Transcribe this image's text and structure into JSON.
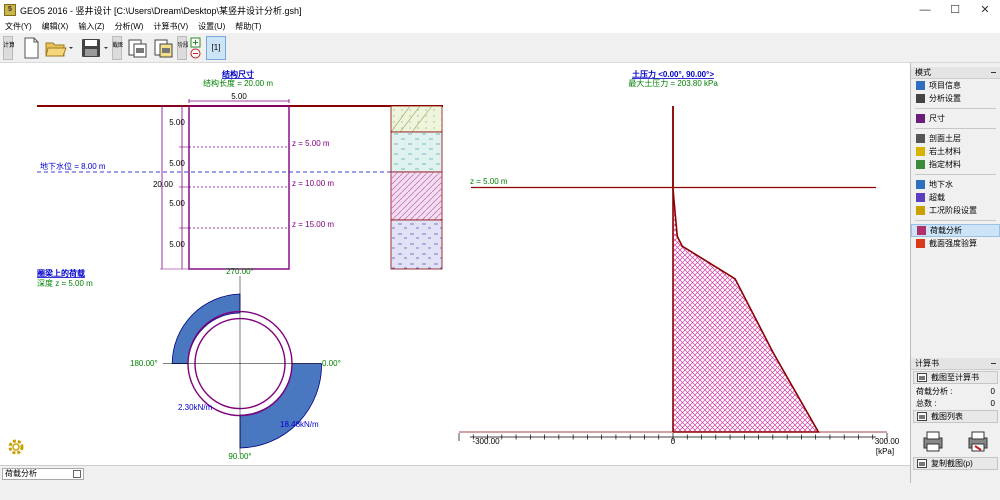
{
  "window": {
    "title": "GEO5 2016 - 竖井设计 [C:\\Users\\Dream\\Desktop\\某竖井设计分析.gsh]",
    "app_icon_text": "5",
    "minimize": "—",
    "maximize": "☐",
    "close": "✕"
  },
  "menu": [
    "文件(Y)",
    "编辑(X)",
    "输入(Z)",
    "分析(W)",
    "计算书(V)",
    "设置(U)",
    "帮助(T)"
  ],
  "toolbar": {
    "vtab1": "计算",
    "vtab2": "截图",
    "vtab3": "阶段",
    "stage_label": "[1]"
  },
  "left_drawing": {
    "title": "结构尺寸",
    "subtitle": "结构长度 = 20.00 m",
    "width_dim": "5.00",
    "seg_dims": [
      "5.00",
      "5.00",
      "5.00",
      "5.00"
    ],
    "total_depth": "20.00",
    "water_label": "地下水位 = 8.00 m",
    "z_labels": [
      "z = 5.00 m",
      "z = 10.00 m",
      "z = 15.00 m"
    ],
    "ring_title": "圈梁上的荷载",
    "ring_depth": "深度 z = 5.00 m",
    "angle_top": "270.00°",
    "angle_left": "180.00°",
    "angle_right": "0.00°",
    "angle_bottom": "90.00°",
    "load_min": "2.30kN/m",
    "load_max": "18.48kN/m"
  },
  "pressure_chart": {
    "title": "土压力 <0.00°, 90.00°>",
    "subtitle": "最大土压力 = 203.80 kPa",
    "z_label": "z = 5.00 m",
    "tick_labels": [
      "-300.00",
      "0",
      "300.00"
    ],
    "unit": "[kPa]"
  },
  "chart_data": {
    "type": "area",
    "title": "土压力 <0.00°, 90.00°>",
    "xlabel": "[kPa]",
    "ylabel": "",
    "xlim": [
      -300,
      300
    ],
    "ylim": [
      0,
      20
    ],
    "x_ticks": [
      -300,
      0,
      300
    ],
    "series": [
      {
        "x": [
          0,
          0,
          1,
          6,
          13,
          87,
          140,
          203.8,
          203.8,
          0
        ],
        "y": [
          0,
          5,
          5.6,
          8,
          8.6,
          10.6,
          15.1,
          20,
          20,
          20
        ]
      }
    ],
    "annotations": [
      "z = 5.00 m",
      "最大土压力 = 203.80 kPa"
    ]
  },
  "right_panel": {
    "mode_header": "模式",
    "modes": [
      {
        "label": "项目信息",
        "icon": "info-icon",
        "color": "#2e6fbf"
      },
      {
        "label": "分析设置",
        "icon": "gear-icon",
        "color": "#444444"
      },
      {
        "label": "尺寸",
        "icon": "dimension-icon",
        "color": "#6a1d7a"
      },
      {
        "label": "剖面土层",
        "icon": "layers-icon",
        "color": "#555555"
      },
      {
        "label": "岩土材料",
        "icon": "soil-icon",
        "color": "#d8b400"
      },
      {
        "label": "指定材料",
        "icon": "assign-icon",
        "color": "#3a8c3a"
      },
      {
        "label": "地下水",
        "icon": "water-icon",
        "color": "#2e6fbf"
      },
      {
        "label": "超载",
        "icon": "surcharge-icon",
        "color": "#5b3fbf"
      },
      {
        "label": "工况阶段设置",
        "icon": "stage-icon",
        "color": "#c9a000"
      },
      {
        "label": "荷载分析",
        "icon": "load-analysis-icon",
        "color": "#b0306a",
        "active": true
      },
      {
        "label": "截面强度验算",
        "icon": "check-icon",
        "color": "#d93b1a"
      }
    ],
    "report_header": "计算书",
    "report_button": "截图至计算书",
    "rows": [
      {
        "label": "荷载分析 :",
        "value": "0"
      },
      {
        "label": "总数 :",
        "value": "0"
      }
    ],
    "list_button": "截图列表",
    "copy_button": "复制截图(p)"
  },
  "status": {
    "mode": "荷载分析"
  },
  "colors": {
    "accent_purple": "#800080",
    "dark_red": "#8b0000",
    "green_text": "#008000",
    "blue_text": "#0000cc",
    "hatch": "#d43ca6"
  }
}
